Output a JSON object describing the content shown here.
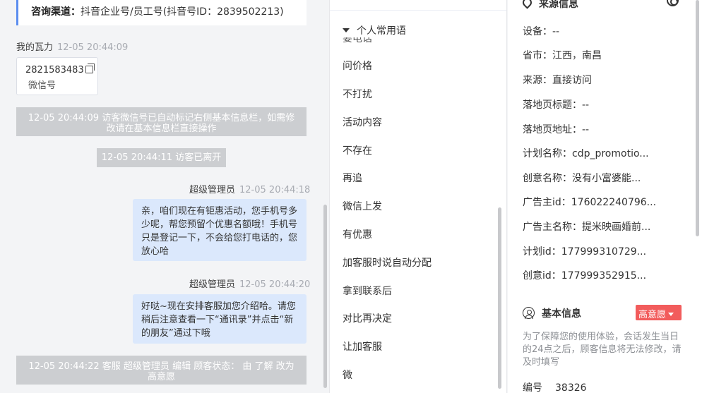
{
  "chat": {
    "top_card": {
      "label": "咨询渠道：",
      "value": "抖音企业号/员工号(抖音号ID：2839502213)"
    },
    "my_card_meta": {
      "sender": "我的瓦力",
      "time": "12-05 20:44:09"
    },
    "wechat_card": {
      "number": "2821583483",
      "label": "微信号"
    },
    "system_messages": [
      "12-05 20:44:09 访客微信号已自动标记右侧基本信息栏，如需修改请在基本信息栏直接操作",
      "12-05 20:44:11 访客已离开",
      "12-05 20:44:22 客服 超级管理员 编辑 顾客状态： 由 了解 改为 高意愿"
    ],
    "messages": [
      {
        "sender": "超级管理员",
        "time": "12-05 20:44:18",
        "text": "亲，咱们现在有钜惠活动，您手机号多少呢，帮您预留个优惠名额哦！手机号只是登记一下，不会给您打电话的，您放心哈"
      },
      {
        "sender": "超级管理员",
        "time": "12-05 20:44:20",
        "text": "好哒~现在安排客服加您介绍哈。请您稍后注意查看一下“通讯录”并点击“新的朋友”通过下哦"
      }
    ]
  },
  "phrases": {
    "header": "个人常用语",
    "cut_item": "要电话",
    "items": [
      "问价格",
      "不打扰",
      "活动内容",
      "不存在",
      "再追",
      "微信上发",
      "有优惠",
      "加客服时说自动分配",
      "拿到联系后",
      "对比再决定",
      "让加客服",
      "微"
    ]
  },
  "source": {
    "title": "来源信息",
    "rows": [
      "设备：--",
      "省市：江西，南昌",
      "来源：直接访问",
      "落地页标题：--",
      "落地页地址：--",
      "计划名称：cdp_promotio...",
      "创意名称：没有小富婆能...",
      "广告主id：176022240796...",
      "广告主名称：提米映画婚前...",
      "计划id：177999310729...",
      "创意id：177999352915..."
    ]
  },
  "basic": {
    "title": "基本信息",
    "badge": "高意愿",
    "notice": "为了保障您的使用体验，会话发生当日的24点之后，顾客信息将无法修改，请及时填写",
    "id_label": "编号",
    "id_value": "38326"
  },
  "colors": {
    "accent": "#5b8def",
    "bubble": "#dbe8fc",
    "badge": "#f25c5c",
    "system": "#ccced1"
  },
  "icons": {
    "source": "location-pin-icon",
    "basic": "user-circle-icon",
    "settings": "gear-icon",
    "copy": "copy-icon",
    "collapse": "caret-down-icon"
  }
}
